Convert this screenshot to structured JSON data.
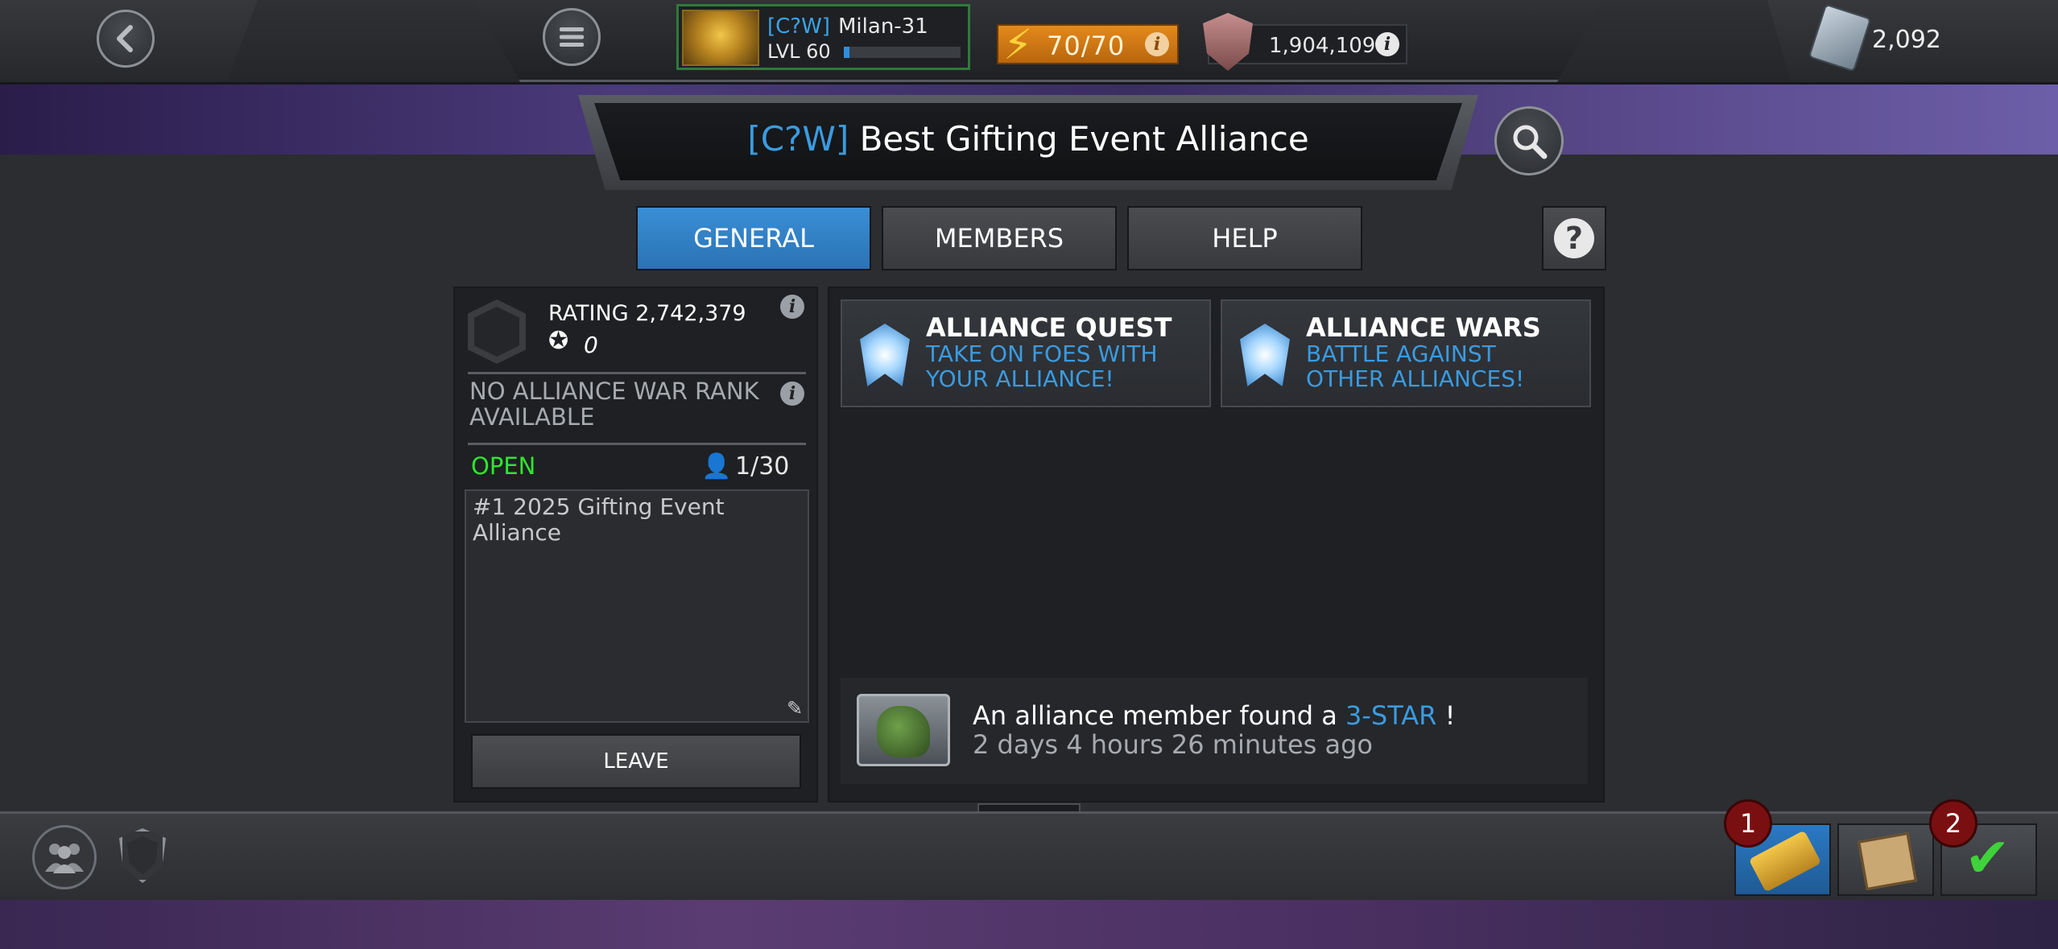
{
  "top_bar": {
    "player": {
      "tag": "[C?W]",
      "name": "Milan-31",
      "level_label": "LVL 60",
      "xp_fraction": 0.05
    },
    "energy": {
      "value": "70/70"
    },
    "shield": {
      "value": "1,904,109"
    },
    "units": {
      "value": "2,092"
    }
  },
  "alliance": {
    "tag": "[C?W]",
    "name": "Best Gifting Event Alliance"
  },
  "tabs": [
    {
      "label": "GENERAL",
      "active": true
    },
    {
      "label": "MEMBERS",
      "active": false
    },
    {
      "label": "HELP",
      "active": false
    }
  ],
  "left_panel": {
    "rating_label": "RATING 2,742,379",
    "star_count": "0",
    "war_rank": "NO ALLIANCE WAR RANK AVAILABLE",
    "status": "OPEN",
    "members": "1/30",
    "description": "#1 2025 Gifting Event Alliance",
    "leave_label": "LEAVE"
  },
  "cards": [
    {
      "title": "ALLIANCE QUEST",
      "subtitle": "TAKE ON FOES WITH YOUR ALLIANCE!"
    },
    {
      "title": "ALLIANCE WARS",
      "subtitle": "BATTLE AGAINST OTHER ALLIANCES!"
    }
  ],
  "activity": {
    "message_prefix": "An alliance member found a",
    "message_highlight": "3-STAR",
    "message_suffix": "!",
    "time": "2 days 4 hours 26 minutes ago"
  },
  "bottom_bar": {
    "notifications": {
      "ticket": "1",
      "check": "2"
    }
  },
  "colors": {
    "accent_blue": "#3a9be0",
    "open_green": "#2ee62e",
    "energy_orange": "#e38a1c",
    "notif_red": "#7a0f12"
  },
  "icons": {
    "back": "back-arrow-icon",
    "menu": "hamburger-menu-icon",
    "energy": "lightning-bolt-icon",
    "info": "info-icon",
    "shield": "shield-icon",
    "units": "units-crystal-icon",
    "search": "search-icon",
    "help": "question-mark-icon",
    "edit": "pencil-icon",
    "member": "person-icon"
  }
}
